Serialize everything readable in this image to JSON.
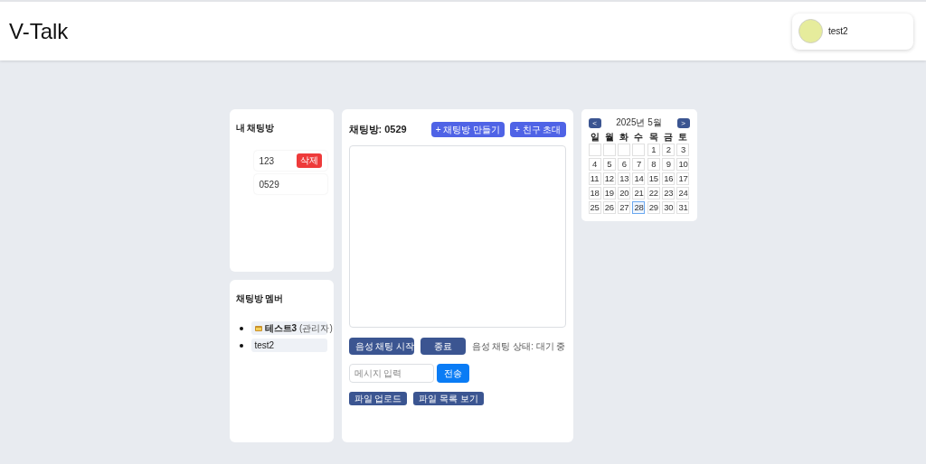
{
  "header": {
    "logo": "V-Talk",
    "user": {
      "name": "test2"
    }
  },
  "rooms_panel": {
    "title": "내 채팅방",
    "rooms": [
      {
        "name": "123",
        "delete_label": "삭제"
      },
      {
        "name": "0529"
      }
    ]
  },
  "members_panel": {
    "title": "채팅방 멤버",
    "members": [
      {
        "kind": "admin",
        "name": "테스트3",
        "role": "(관리자)"
      },
      {
        "kind": "member",
        "name": "test2"
      }
    ]
  },
  "chat": {
    "title": "채팅방: 0529",
    "actions": [
      "+ 채팅방 만들기",
      "+ 친구 초대"
    ],
    "voice_start": "음성 채팅 시작",
    "voice_end": "종료",
    "voice_status": "음성 채팅 상태: 대기 중",
    "message_placeholder": "메시지 입력",
    "send": "전송",
    "file_buttons": [
      "파일 업로드",
      "파일 목록 보기"
    ]
  },
  "calendar": {
    "prev": "<",
    "month": "2025년 5월",
    "next": ">",
    "weekdays": [
      "일",
      "월",
      "화",
      "수",
      "목",
      "금",
      "토"
    ],
    "days": [
      {
        "kind": "blank"
      },
      {
        "kind": "blank"
      },
      {
        "kind": "blank"
      },
      {
        "kind": "blank"
      },
      {
        "kind": "day",
        "label": "1",
        "selected": false
      },
      {
        "kind": "day",
        "label": "2",
        "selected": false
      },
      {
        "kind": "day",
        "label": "3",
        "selected": false
      },
      {
        "kind": "day",
        "label": "4",
        "selected": false
      },
      {
        "kind": "day",
        "label": "5",
        "selected": false
      },
      {
        "kind": "day",
        "label": "6",
        "selected": false
      },
      {
        "kind": "day",
        "label": "7",
        "selected": false
      },
      {
        "kind": "day",
        "label": "8",
        "selected": false
      },
      {
        "kind": "day",
        "label": "9",
        "selected": false
      },
      {
        "kind": "day",
        "label": "10",
        "selected": false
      },
      {
        "kind": "day",
        "label": "11",
        "selected": false
      },
      {
        "kind": "day",
        "label": "12",
        "selected": false
      },
      {
        "kind": "day",
        "label": "13",
        "selected": false
      },
      {
        "kind": "day",
        "label": "14",
        "selected": false
      },
      {
        "kind": "day",
        "label": "15",
        "selected": false
      },
      {
        "kind": "day",
        "label": "16",
        "selected": false
      },
      {
        "kind": "day",
        "label": "17",
        "selected": false
      },
      {
        "kind": "day",
        "label": "18",
        "selected": false
      },
      {
        "kind": "day",
        "label": "19",
        "selected": false
      },
      {
        "kind": "day",
        "label": "20",
        "selected": false
      },
      {
        "kind": "day",
        "label": "21",
        "selected": false
      },
      {
        "kind": "day",
        "label": "22",
        "selected": false
      },
      {
        "kind": "day",
        "label": "23",
        "selected": false
      },
      {
        "kind": "day",
        "label": "24",
        "selected": false
      },
      {
        "kind": "day",
        "label": "25",
        "selected": false
      },
      {
        "kind": "day",
        "label": "26",
        "selected": false
      },
      {
        "kind": "day",
        "label": "27",
        "selected": false
      },
      {
        "kind": "day",
        "label": "28",
        "selected": true
      },
      {
        "kind": "day",
        "label": "29",
        "selected": false
      },
      {
        "kind": "day",
        "label": "30",
        "selected": false
      },
      {
        "kind": "day",
        "label": "31",
        "selected": false
      }
    ]
  }
}
